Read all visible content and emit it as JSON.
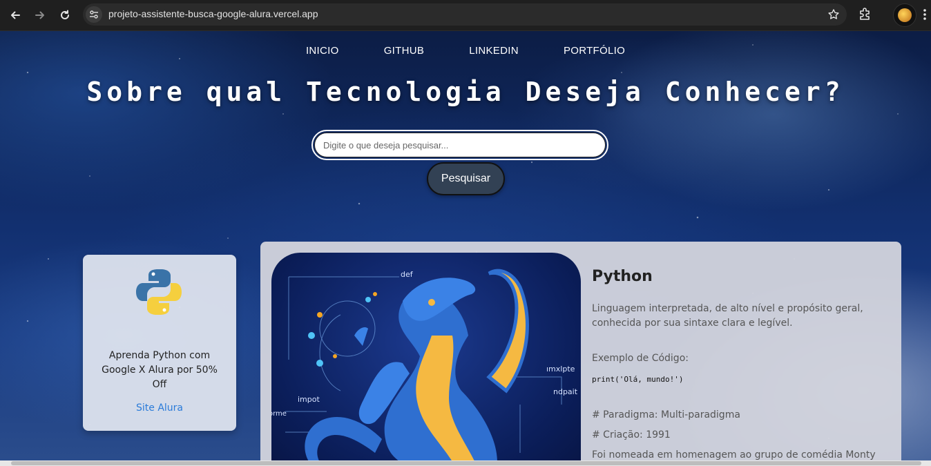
{
  "browser": {
    "url": "projeto-assistente-busca-google-alura.vercel.app"
  },
  "nav": {
    "items": [
      "INICIO",
      "GITHUB",
      "LINKEDIN",
      "PORTFÓLIO"
    ]
  },
  "hero": {
    "title": "Sobre qual Tecnologia Deseja Conhecer?"
  },
  "search": {
    "placeholder": "Digite o que deseja pesquisar...",
    "value": "",
    "button_label": "Pesquisar"
  },
  "ad": {
    "text": "Aprenda Python com Google X Alura por 50% Off",
    "link_label": "Site Alura"
  },
  "result": {
    "title": "Python",
    "description": "Linguagem interpretada, de alto nível e propósito geral, conhecida por sua sintaxe clara e legível.",
    "code_label": "Exemplo de Código:",
    "code": "print('Olá, mundo!')",
    "paradigm": "# Paradigma: Multi-paradigma",
    "creation": "# Criação: 1991",
    "trivia": "Foi nomeada em homenagem ao grupo de comédia Monty",
    "image_labels": [
      "def",
      "impot",
      "ımxlpte",
      "ndpait",
      "orme"
    ]
  },
  "colors": {
    "button_bg": "#324154",
    "link": "#2a7bd9",
    "python_blue": "#3a73a8",
    "python_yellow": "#f5cf3e"
  },
  "icons": {
    "back": "arrow-left-icon",
    "forward": "arrow-right-icon",
    "reload": "reload-icon",
    "site_info": "tune-icon",
    "bookmark": "star-icon",
    "extensions": "puzzle-icon",
    "menu": "kebab-icon"
  }
}
